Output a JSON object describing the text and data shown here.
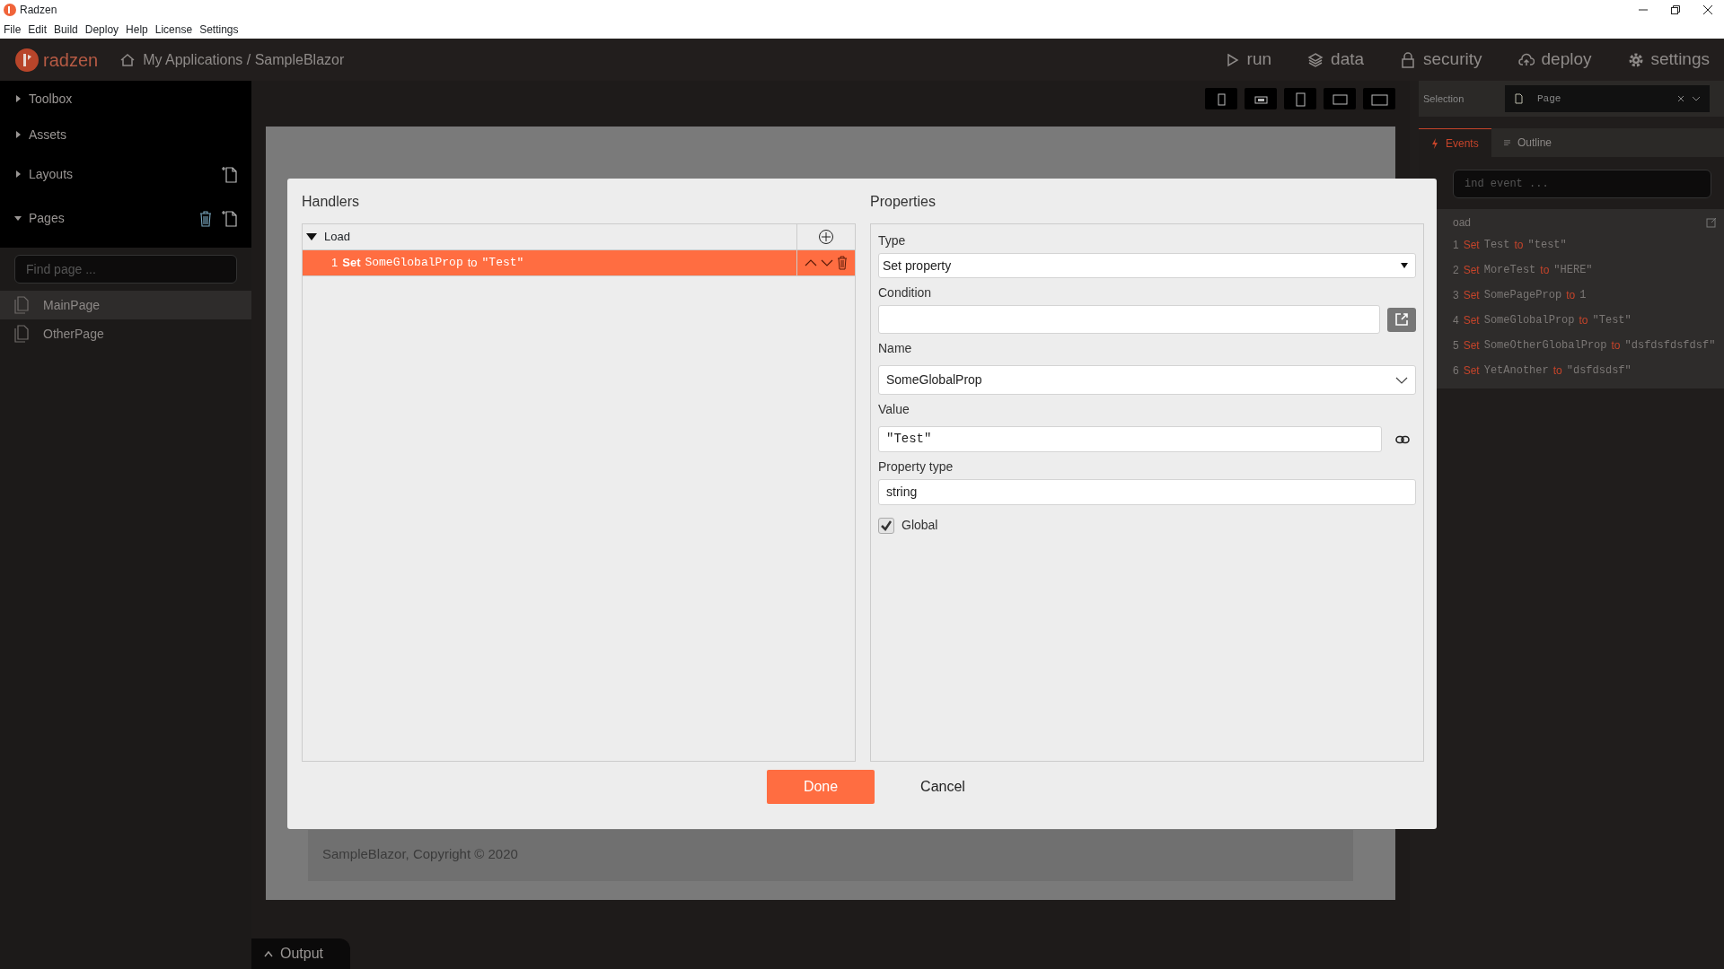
{
  "window": {
    "title": "Radzen"
  },
  "menu": [
    "File",
    "Edit",
    "Build",
    "Deploy",
    "Help",
    "License",
    "Settings"
  ],
  "header": {
    "logo": "radzen",
    "breadcrumb": "My Applications / SampleBlazor",
    "nav": [
      {
        "label": "run"
      },
      {
        "label": "data"
      },
      {
        "label": "security"
      },
      {
        "label": "deploy"
      },
      {
        "label": "settings"
      }
    ]
  },
  "sidebar": {
    "sections": [
      {
        "label": "Toolbox",
        "expanded": false
      },
      {
        "label": "Assets",
        "expanded": false
      },
      {
        "label": "Layouts",
        "expanded": false
      },
      {
        "label": "Pages",
        "expanded": true
      }
    ],
    "search": {
      "placeholder": "Find page ..."
    },
    "pages": [
      {
        "label": "MainPage",
        "selected": true
      },
      {
        "label": "OtherPage",
        "selected": false
      }
    ]
  },
  "toolbar": {
    "selection_label": "Selection",
    "selection": "Page"
  },
  "right_panel": {
    "tabs": [
      {
        "label": "Events",
        "selected": true
      },
      {
        "label": "Outline",
        "selected": false
      }
    ],
    "search": {
      "placeholder": "ind event ..."
    },
    "event": "oad",
    "actions": [
      {
        "number": "1",
        "verb": "Set",
        "target": "Test",
        "op": "to",
        "value": "\"test\""
      },
      {
        "number": "2",
        "verb": "Set",
        "target": "MoreTest",
        "op": "to",
        "value": "\"HERE\""
      },
      {
        "number": "3",
        "verb": "Set",
        "target": "SomePageProp",
        "op": "to",
        "value": "1"
      },
      {
        "number": "4",
        "verb": "Set",
        "target": "SomeGlobalProp",
        "op": "to",
        "value": "\"Test\""
      },
      {
        "number": "5",
        "verb": "Set",
        "target": "SomeOtherGlobalProp",
        "op": "to",
        "value": "\"dsfdsfdsfdsf\""
      },
      {
        "number": "6",
        "verb": "Set",
        "target": "YetAnother",
        "op": "to",
        "value": "\"dsfdsdsf\""
      }
    ]
  },
  "canvas": {
    "footer": "SampleBlazor, Copyright © 2020"
  },
  "dialog": {
    "handlers": {
      "title": "Handlers",
      "event": {
        "label": "Load",
        "expanded": true
      },
      "rows": [
        {
          "number": "1",
          "verb": "Set",
          "target": "SomeGlobalProp",
          "op": "to",
          "value": "\"Test\"",
          "selected": true
        }
      ]
    },
    "properties": {
      "title": "Properties",
      "fields": [
        {
          "kind": "select",
          "label": "Type",
          "value": "Set property"
        },
        {
          "kind": "expression",
          "label": "Condition"
        },
        {
          "kind": "dropdown",
          "label": "Name",
          "value": "SomeGlobalProp"
        },
        {
          "kind": "binding",
          "label": "Value",
          "value": "\"Test\""
        },
        {
          "kind": "text",
          "label": "Property type",
          "value": "string"
        },
        {
          "kind": "checkbox",
          "label": "Global",
          "checked": true
        }
      ]
    },
    "buttons": [
      {
        "label": "Done",
        "kind": "primary"
      },
      {
        "label": "Cancel",
        "kind": "link"
      }
    ]
  },
  "output": {
    "label": "Output"
  }
}
